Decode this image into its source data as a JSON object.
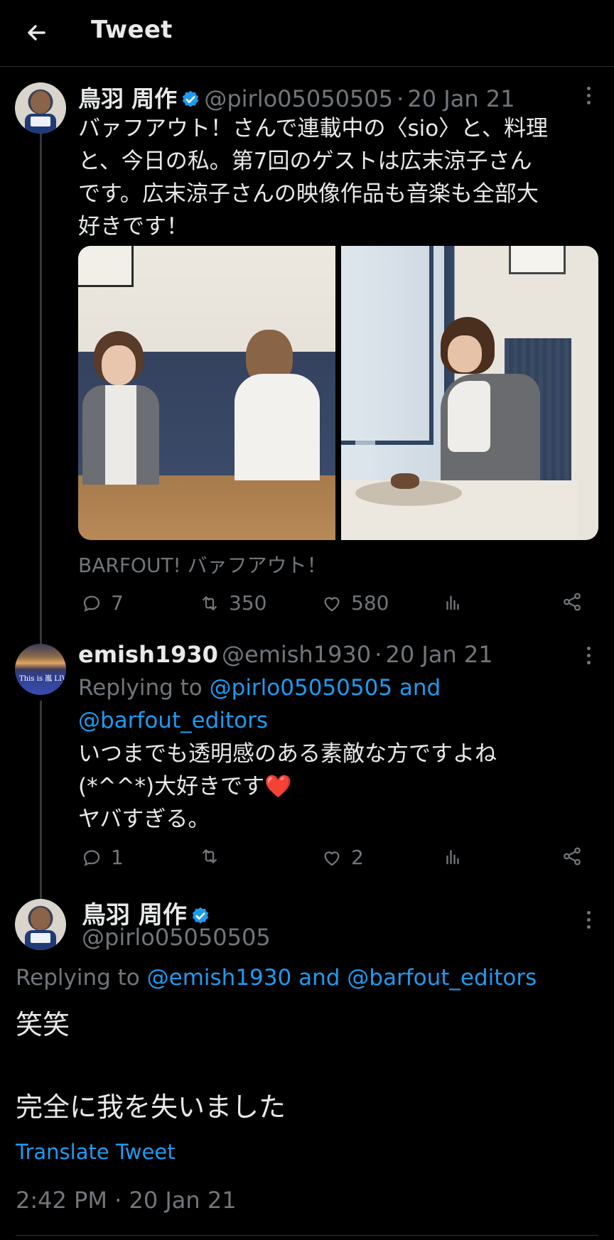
{
  "header": {
    "title": "Tweet"
  },
  "tweet1": {
    "name": "鳥羽 周作",
    "handle": "@pirlo05050505",
    "sep": "·",
    "date": "20 Jan 21",
    "lines": [
      "バァフアウト！さんで連載中の〈sio〉と、料理",
      "と、今日の私。第7回のゲストは広末涼子さん",
      "です。広末涼子さんの映像作品も音楽も全部大",
      "好きです！"
    ],
    "source": "BARFOUT! バァフアウト！",
    "replies": "7",
    "retweets": "350",
    "likes": "580"
  },
  "tweet2": {
    "name": "emish1930",
    "handle": "@emish1930",
    "sep": "·",
    "date": "20 Jan 21",
    "replying_prefix": "Replying to",
    "replying_to_1": "@pirlo05050505",
    "replying_and": "and",
    "replying_to_2": "@barfout_editors",
    "lines": [
      "いつまでも透明感のある素敵な方ですよね",
      "(*^^*)大好きです❤️",
      "ヤバすぎる。"
    ],
    "avatar_text": "This is 嵐 LIVE",
    "replies": "1",
    "retweets": "",
    "likes": "2"
  },
  "tweet3": {
    "name": "鳥羽 周作",
    "handle": "@pirlo05050505",
    "replying_prefix": "Replying to",
    "replying_to_1": "@emish1930",
    "replying_and": "and",
    "replying_to_2": "@barfout_editors",
    "line1": "笑笑",
    "line2": "完全に我を失いました",
    "translate": "Translate Tweet",
    "timestamp": "2:42 PM · 20 Jan 21"
  },
  "colors": {
    "accent": "#1d9bf0",
    "muted": "#71767b",
    "text": "#e7e9ea",
    "background": "#000000"
  }
}
